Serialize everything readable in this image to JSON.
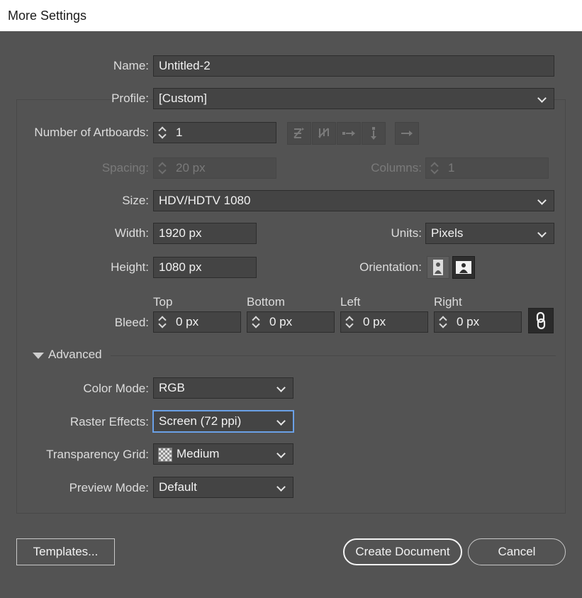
{
  "window": {
    "title": "More Settings"
  },
  "form": {
    "name_label": "Name:",
    "name_value": "Untitled-2",
    "profile_label": "Profile:",
    "profile_value": "[Custom]",
    "artboards_label": "Number of Artboards:",
    "artboards_value": "1",
    "spacing_label": "Spacing:",
    "spacing_value": "20 px",
    "columns_label": "Columns:",
    "columns_value": "1",
    "size_label": "Size:",
    "size_value": "HDV/HDTV 1080",
    "width_label": "Width:",
    "width_value": "1920 px",
    "height_label": "Height:",
    "height_value": "1080 px",
    "units_label": "Units:",
    "units_value": "Pixels",
    "orientation_label": "Orientation:",
    "bleed_label": "Bleed:",
    "bleed": {
      "top_label": "Top",
      "top_value": "0 px",
      "bottom_label": "Bottom",
      "bottom_value": "0 px",
      "left_label": "Left",
      "left_value": "0 px",
      "right_label": "Right",
      "right_value": "0 px"
    }
  },
  "advanced": {
    "toggle_label": "Advanced",
    "color_mode_label": "Color Mode:",
    "color_mode_value": "RGB",
    "raster_label": "Raster Effects:",
    "raster_value": "Screen (72 ppi)",
    "transparency_label": "Transparency Grid:",
    "transparency_value": "Medium",
    "preview_label": "Preview Mode:",
    "preview_value": "Default"
  },
  "buttons": {
    "templates": "Templates...",
    "create": "Create Document",
    "cancel": "Cancel"
  },
  "icons": {
    "artboard_layout": [
      "grid-by-row-icon",
      "grid-by-column-icon",
      "arrange-by-row-icon",
      "arrange-by-column-icon",
      "right-to-left-icon"
    ],
    "link": "chain-link-icon",
    "portrait": "portrait-orientation-icon",
    "landscape": "landscape-orientation-icon"
  },
  "colors": {
    "background": "#535353",
    "field": "#444444",
    "focus": "#6aa0e6"
  }
}
